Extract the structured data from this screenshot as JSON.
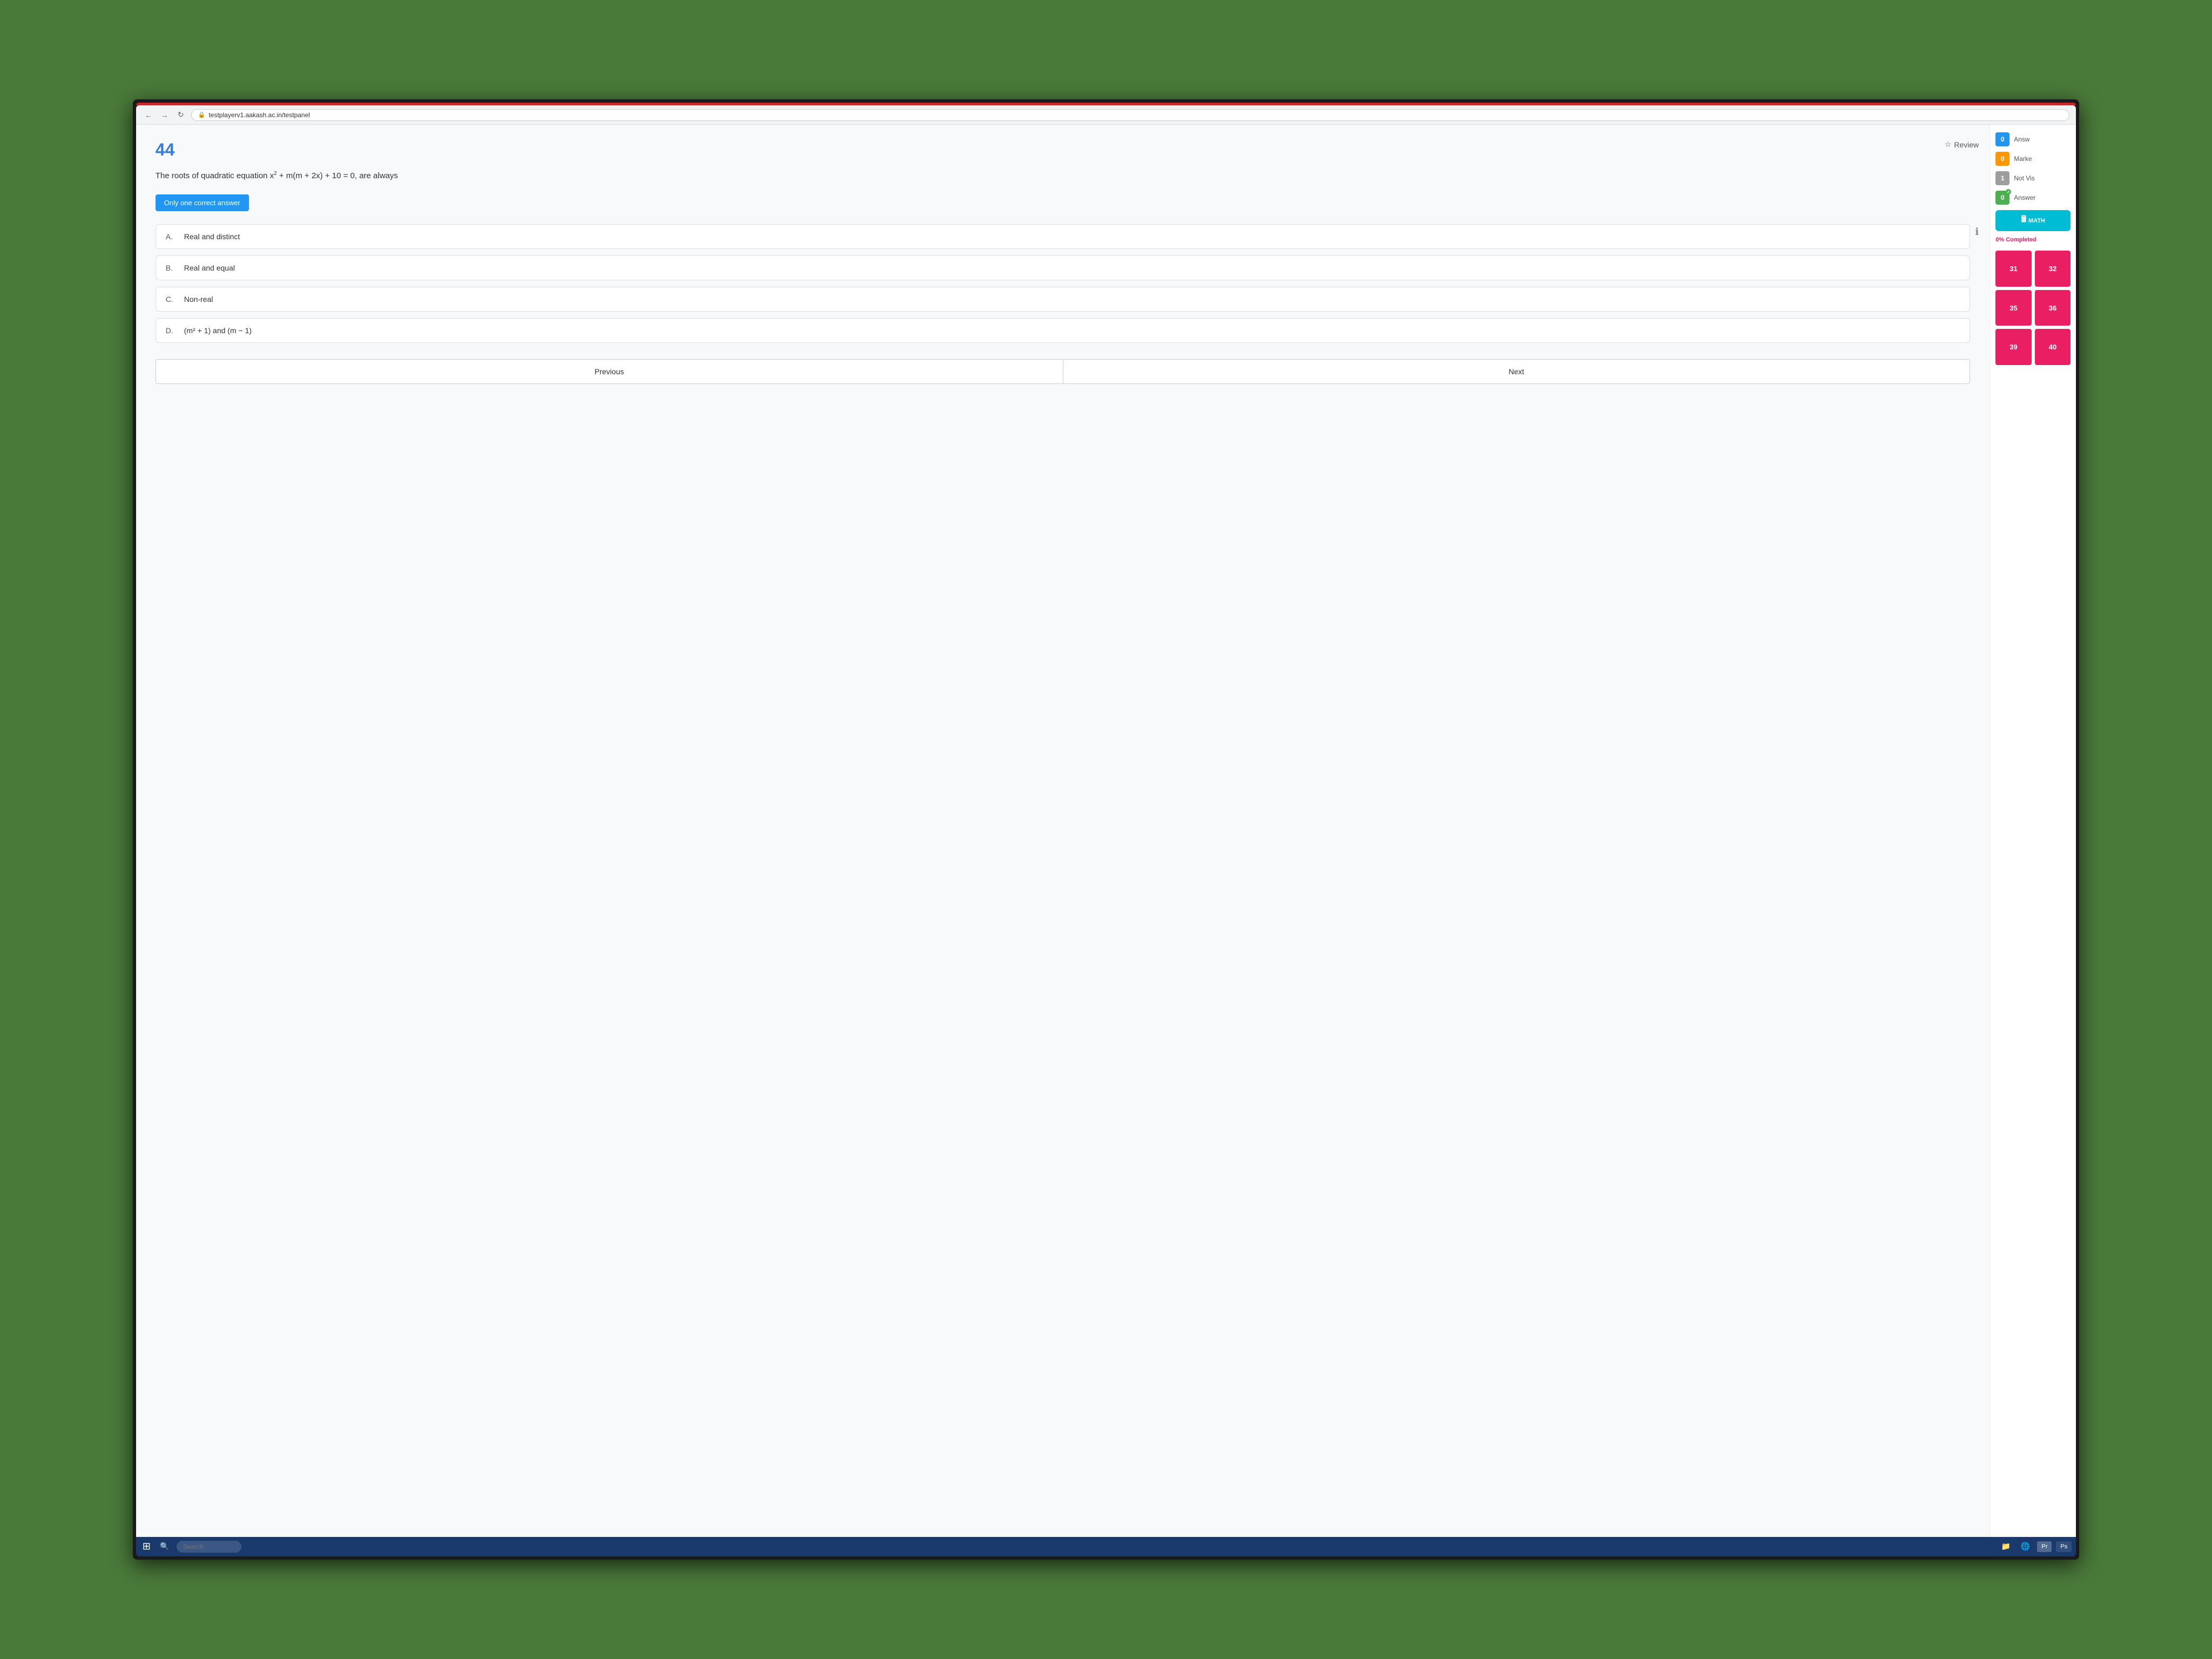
{
  "browser": {
    "url": "testplayerv1.aakash.ac.in/testpanel",
    "back_label": "←",
    "forward_label": "→",
    "reload_label": "↻"
  },
  "question": {
    "number": "44",
    "review_label": "Review",
    "text_prefix": "The roots of quadratic equation x",
    "text_sup": "2",
    "text_suffix": " + m(m + 2x) + 10 = 0, are always",
    "answer_type": "Only one correct answer",
    "info_symbol": "ℹ",
    "options": [
      {
        "label": "A.",
        "text": "Real and distinct"
      },
      {
        "label": "B.",
        "text": "Real and equal"
      },
      {
        "label": "C.",
        "text": "Non-real"
      },
      {
        "label": "D.",
        "text": "(m² + 1) and (m − 1)"
      }
    ],
    "prev_label": "Previous",
    "next_label": "Next"
  },
  "sidebar": {
    "answered_label": "Answ",
    "marked_label": "Marke",
    "not_visited_label": "Not Vis",
    "answered_marked_label": "Answer",
    "answered_count": "0",
    "marked_count": "0",
    "not_visited_count": "1",
    "answered_marked_count": "0",
    "subject_label": "MATH",
    "progress": "0% Completed",
    "question_numbers": [
      "31",
      "32",
      "35",
      "36",
      "39",
      "40"
    ]
  },
  "taskbar": {
    "windows_label": "⊞",
    "search_placeholder": "Search",
    "apps": [
      "Pr",
      "Ps"
    ]
  }
}
